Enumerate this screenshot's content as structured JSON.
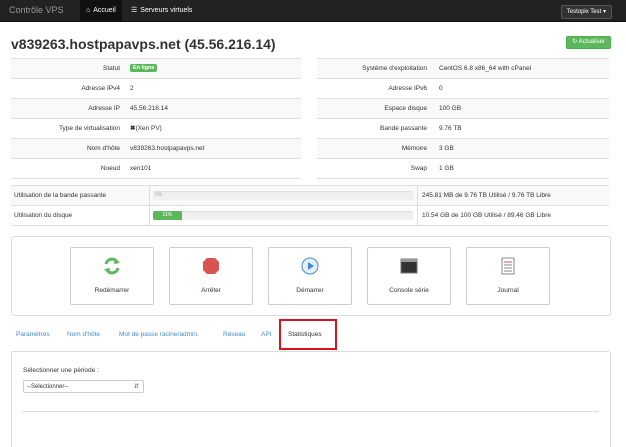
{
  "navbar": {
    "brand": "Contrôle VPS",
    "home": "Accueil",
    "servers": "Serveurs virtuels",
    "user": "Testopix Test"
  },
  "header": {
    "title": "v839263.hostpapavps.net (45.56.216.14)",
    "refresh": "Actualiser"
  },
  "info_left": [
    {
      "label": "Statut",
      "value": "En ligne"
    },
    {
      "label": "Adresse IPv4",
      "value": "2"
    },
    {
      "label": "Adresse IP",
      "value": "45.56.216.14"
    },
    {
      "label": "Type de virtualisation",
      "value": "(Xen PV)"
    },
    {
      "label": "Nom d'hôte",
      "value": "v839263.hostpapavps.net"
    },
    {
      "label": "Noeud",
      "value": "xen101"
    }
  ],
  "info_right": [
    {
      "label": "Système d'exploitation",
      "value": "CentOS 6.8 x86_64 with cPanel"
    },
    {
      "label": "Adresse IPv6",
      "value": "0"
    },
    {
      "label": "Espace disque",
      "value": "100 GB"
    },
    {
      "label": "Bande passante",
      "value": "9.76 TB"
    },
    {
      "label": "Mémoire",
      "value": "3 GB"
    },
    {
      "label": "Swap",
      "value": "1 GB"
    }
  ],
  "usage": [
    {
      "label": "Utilisation de la bande passante",
      "percent": 0,
      "bar_text": "0%",
      "text": "245.81 MB de 9.76 TB Utilisé / 9.76 TB Libre"
    },
    {
      "label": "Utilisation du disque",
      "percent": 11,
      "bar_text": "11%",
      "text": "10.54 GB de 100 GB Utilisé / 89.46 GB Libre"
    }
  ],
  "actions": [
    {
      "label": "Redémarrer",
      "icon": "reboot-icon"
    },
    {
      "label": "Arrêter",
      "icon": "stop-icon"
    },
    {
      "label": "Démarrer",
      "icon": "play-icon"
    },
    {
      "label": "Console série",
      "icon": "console-icon"
    },
    {
      "label": "Journal",
      "icon": "log-icon"
    }
  ],
  "tabs": [
    "Paramètres",
    "Nom d'hôte",
    "Mot de passe racine/admin.",
    "Réseau",
    "API",
    "Statistiques"
  ],
  "active_tab": "Statistiques",
  "period": {
    "label": "Sélectionner une période :",
    "selected": "--Sélectionner--"
  },
  "colors": {
    "success": "#5cb85c",
    "link": "#428bca",
    "highlight": "#d9121c",
    "navbar": "#222222"
  }
}
